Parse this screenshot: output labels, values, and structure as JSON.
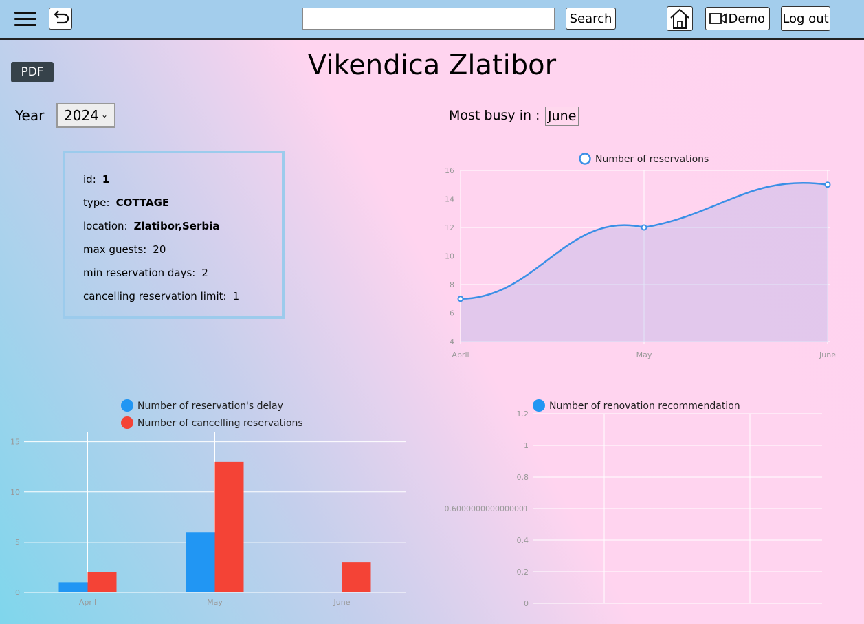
{
  "topbar": {
    "search_placeholder": "",
    "search_label": "Search",
    "demo_label": "Demo",
    "logout_label": "Log out",
    "icons": {
      "menu": "hamburger-menu-icon",
      "back": "undo-arrow-icon",
      "home": "home-icon",
      "demo": "video-camera-icon"
    }
  },
  "page": {
    "pdf_label": "PDF",
    "title": "Vikendica Zlatibor",
    "year_label": "Year",
    "year_value": "2024",
    "busy_label": "Most busy in :",
    "busy_value": "June"
  },
  "info": {
    "id_label": "id:",
    "id_value": "1",
    "type_label": "type:",
    "type_value": "COTTAGE",
    "location_label": "location:",
    "location_value": "Zlatibor,Serbia",
    "max_guests_label": "max guests:",
    "max_guests_value": "20",
    "min_days_label": "min reservation days:",
    "min_days_value": "2",
    "cancel_label": "cancelling reservation limit:",
    "cancel_value": "1"
  },
  "chart_data": [
    {
      "type": "line",
      "categories": [
        "April",
        "May",
        "June"
      ],
      "series": [
        {
          "name": "Number of reservations",
          "values": [
            7,
            12,
            15
          ],
          "color": "#3a8fe6"
        }
      ],
      "yticks": [
        "4",
        "6",
        "8",
        "10",
        "12",
        "14",
        "16"
      ],
      "ylim": [
        4,
        16
      ],
      "legend": "top-center",
      "grid": true
    },
    {
      "type": "bar",
      "categories": [
        "April",
        "May",
        "June"
      ],
      "series": [
        {
          "name": "Number of reservation's delay",
          "values": [
            1,
            6,
            0
          ],
          "color": "#2196f3"
        },
        {
          "name": "Number of cancelling reservations",
          "values": [
            2,
            13,
            3
          ],
          "color": "#f44336"
        }
      ],
      "yticks": [
        "0",
        "5",
        "10",
        "15"
      ],
      "ylim": [
        0,
        16
      ],
      "legend": "top-center",
      "grid": true
    },
    {
      "type": "bar",
      "categories": [],
      "series": [
        {
          "name": "Number of renovation recommendation",
          "values": [],
          "color": "#2196f3"
        }
      ],
      "yticks": [
        "0",
        "0.2",
        "0.4",
        "0.6000000000000001",
        "0.8",
        "1",
        "1.2"
      ],
      "ylim": [
        0,
        1.2
      ],
      "legend": "top-center",
      "grid": true
    }
  ]
}
